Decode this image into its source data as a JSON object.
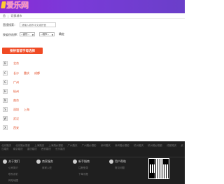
{
  "header": {
    "logo_text": "爱乐网"
  },
  "breadcrumb": {
    "home": "首",
    "separator": "|",
    "current": "切换城市"
  },
  "search": {
    "label": "直接搜索：",
    "placeholder": "请输入城市中文或拼音"
  },
  "province_select": {
    "label": "按省份选择：",
    "province_value": "--省份--",
    "city_value": "--城市--",
    "confirm": "确定"
  },
  "banner": {
    "text": "按拼音首字母选择"
  },
  "letters": [
    {
      "letter": "B",
      "cities": [
        "北京"
      ]
    },
    {
      "letter": "C",
      "cities": [
        "长沙",
        "重庆",
        "成都"
      ]
    },
    {
      "letter": "G",
      "cities": [
        "广州"
      ]
    },
    {
      "letter": "H",
      "cities": [
        "杭州"
      ]
    },
    {
      "letter": "N",
      "cities": [
        "南京"
      ]
    },
    {
      "letter": "S",
      "cities": [
        "深圳",
        "上海"
      ]
    },
    {
      "letter": "W",
      "cities": [
        "武汉"
      ]
    },
    {
      "letter": "X",
      "cities": [
        "西安"
      ]
    }
  ],
  "footer": {
    "links": [
      "北京婚庆",
      "北京婚纱摄影",
      "上海婚庆",
      "上海婚纱摄影",
      "广州婚庆",
      "广州婚纱摄影",
      "深圳婚庆",
      "深圳婚纱摄影",
      "杭州婚庆",
      "杭州婚纱摄影",
      "成都婚庆",
      "武汉婚庆",
      "南京婚庆",
      "重庆婚庆",
      "西安婚庆",
      "长沙婚庆"
    ],
    "columns": [
      {
        "title": "关于我们",
        "items": [
          "公司简介",
          "联系我们",
          "网站地图"
        ]
      },
      {
        "title": "商家服务",
        "items": [
          "商家入驻"
        ]
      },
      {
        "title": "新手指南",
        "items": [
          "注册登录",
          "下单流程"
        ]
      },
      {
        "title": "用户帮助",
        "items": [
          "常见问题"
        ]
      }
    ]
  }
}
